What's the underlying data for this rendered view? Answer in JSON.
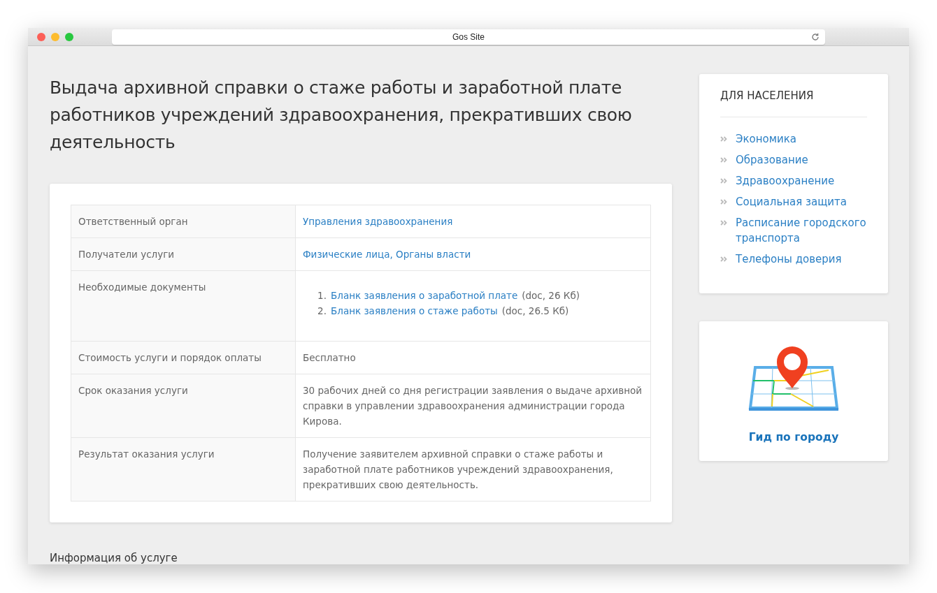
{
  "window": {
    "title": "Gos Site"
  },
  "page_title": "Выдача архивной справки о стаже работы и заработной плате работников учреждений здравоохранения, прекративших свою деятельность",
  "table": {
    "rows": [
      {
        "label": "Ответственный орган",
        "kind": "link",
        "value": "Управления здравоохранения"
      },
      {
        "label": "Получатели услуги",
        "kind": "link",
        "value": "Физические лица, Органы власти"
      },
      {
        "label": "Необходимые документы",
        "kind": "docs",
        "documents": [
          {
            "number": "1.",
            "link": "Бланк заявления о заработной плате",
            "meta": "(doc, 26 Кб)"
          },
          {
            "number": "2.",
            "link": "Бланк заявления о стаже работы",
            "meta": "(doc, 26.5 Кб)"
          }
        ]
      },
      {
        "label": "Стоимость услуги и порядок оплаты",
        "kind": "text",
        "value": "Бесплатно"
      },
      {
        "label": "Срок оказания услуги",
        "kind": "text",
        "value": "30 рабочих дней со дня регистрации заявления о выдаче архивной справки в управлении здравоохранения администрации города Кирова."
      },
      {
        "label": "Результат оказания услуги",
        "kind": "text",
        "value": "Получение заявителем архивной справки о стаже работы и заработной плате работников учреждений здравоохранения, прекративших свою деятельность."
      }
    ]
  },
  "footer_text": "Информация об услуге",
  "sidebar": {
    "title": "ДЛЯ НАСЕЛЕНИЯ",
    "items": [
      "Экономика",
      "Образование",
      "Здравоохранение",
      "Социальная защита",
      "Расписание городского транспорта",
      "Телефоны доверия"
    ]
  },
  "city_guide": {
    "label": "Гид по городу"
  }
}
